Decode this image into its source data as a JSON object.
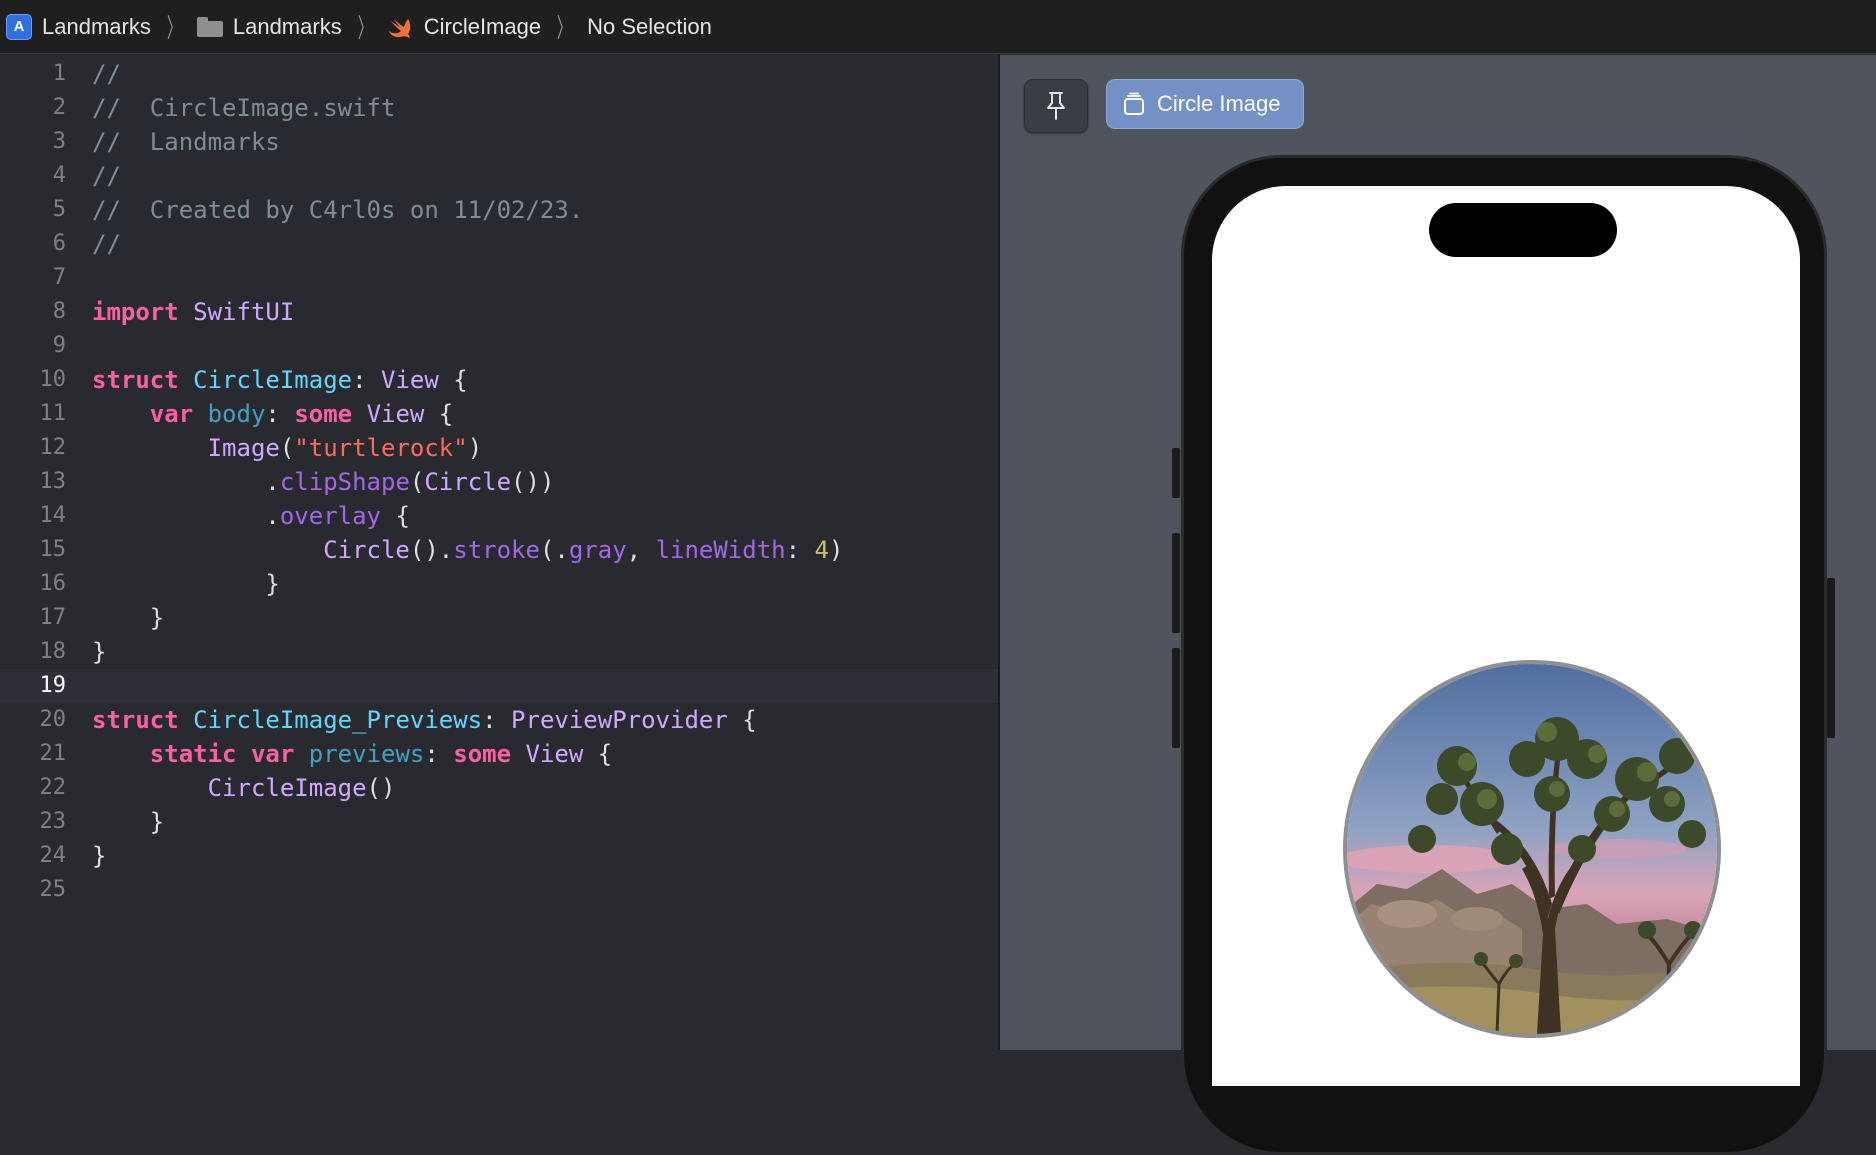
{
  "breadcrumb": {
    "project": "Landmarks",
    "group": "Landmarks",
    "file": "CircleImage",
    "selection": "No Selection"
  },
  "editor": {
    "current_line": 19,
    "lines": [
      {
        "n": "1",
        "text": "//"
      },
      {
        "n": "2",
        "text": "//  CircleImage.swift"
      },
      {
        "n": "3",
        "text": "//  Landmarks"
      },
      {
        "n": "4",
        "text": "//"
      },
      {
        "n": "5",
        "text": "//  Created by C4rl0s on 11/02/23."
      },
      {
        "n": "6",
        "text": "//"
      },
      {
        "n": "7",
        "text": ""
      },
      {
        "n": "8",
        "text": "import SwiftUI"
      },
      {
        "n": "9",
        "text": ""
      },
      {
        "n": "10",
        "text": "struct CircleImage: View {"
      },
      {
        "n": "11",
        "text": "    var body: some View {"
      },
      {
        "n": "12",
        "text": "        Image(\"turtlerock\")"
      },
      {
        "n": "13",
        "text": "            .clipShape(Circle())"
      },
      {
        "n": "14",
        "text": "            .overlay {"
      },
      {
        "n": "15",
        "text": "                Circle().stroke(.gray, lineWidth: 4)"
      },
      {
        "n": "16",
        "text": "            }"
      },
      {
        "n": "17",
        "text": "    }"
      },
      {
        "n": "18",
        "text": "}"
      },
      {
        "n": "19",
        "text": ""
      },
      {
        "n": "20",
        "text": "struct CircleImage_Previews: PreviewProvider {"
      },
      {
        "n": "21",
        "text": "    static var previews: some View {"
      },
      {
        "n": "22",
        "text": "        CircleImage()"
      },
      {
        "n": "23",
        "text": "    }"
      },
      {
        "n": "24",
        "text": "}"
      },
      {
        "n": "25",
        "text": ""
      }
    ]
  },
  "canvas": {
    "pin_icon": "pin-icon",
    "preview_tab_label": "Circle Image",
    "preview_tab_icon": "preview-stack-icon",
    "device": "iphone",
    "image_subject": "joshua-tree-at-sunset"
  },
  "colors": {
    "keyword": "#fc5fa3",
    "type_decl": "#5dd8ff",
    "type_ref": "#d0a8ff",
    "function": "#a167e6",
    "string": "#fc6a5d",
    "number": "#d0bf69",
    "comment": "#7f8c98",
    "tab_selected": "#7391c7"
  }
}
